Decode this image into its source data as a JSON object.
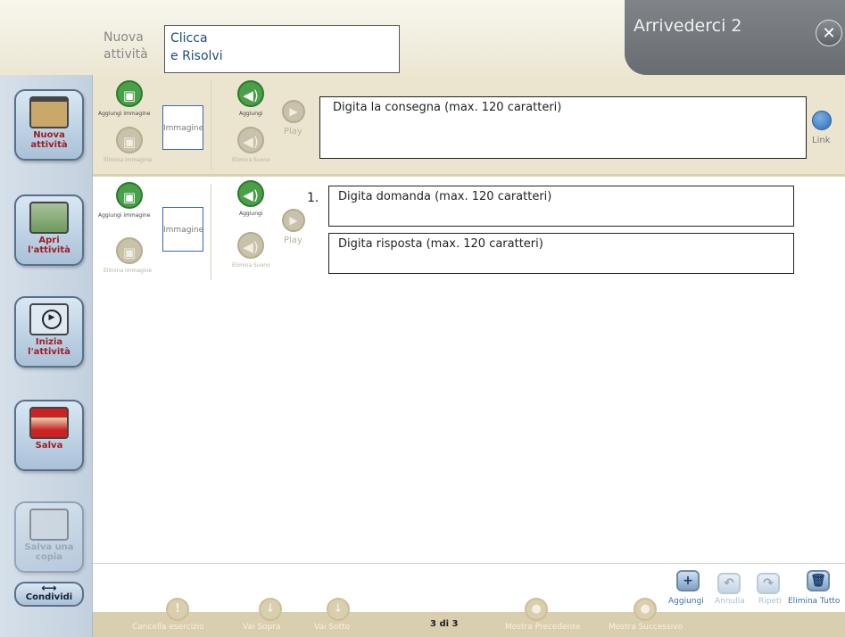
{
  "header": {
    "nuova_attivita": "Nuova attività",
    "title_line1": "Clicca",
    "title_line2": "e Risolvi",
    "app_title": "Arrivederci 2",
    "close_glyph": "✕"
  },
  "sidebar": {
    "items": [
      {
        "label": "Nuova attività",
        "icon": "folder-icon"
      },
      {
        "label": "Apri l'attività",
        "icon": "open-folder-icon"
      },
      {
        "label": "Inizia l'attività",
        "icon": "play-icon"
      },
      {
        "label": "Salva",
        "icon": "save-icon"
      },
      {
        "label": "Salva una copia",
        "icon": "copy-icon"
      }
    ],
    "share_label": "Condividi"
  },
  "instruction": {
    "add_image": "Aggiungi immagine",
    "remove_image": "Elimina immagine",
    "image_placeholder": "Immagine",
    "add_sound": "Aggiungi",
    "remove_sound": "Elimina Suono",
    "play": "Play",
    "text": "Digita  la consegna (max. 120 caratteri)",
    "link": "Link"
  },
  "question": {
    "number": "1.",
    "add_image": "Aggiungi immagine",
    "remove_image": "Elimina immagine",
    "image_placeholder": "Immagine",
    "add_sound": "Aggiungi",
    "remove_sound": "Elimina Suono",
    "play": "Play",
    "question_text": "Digita domanda (max. 120 caratteri)",
    "answer_text": "Digita risposta (max. 120 caratteri)"
  },
  "toolbar": {
    "add": "Aggiungi",
    "undo": "Annulla",
    "redo": "Ripeti",
    "delete_all": "Elimina Tutto"
  },
  "bottom": {
    "delete_exercise": "Cancella esercizio",
    "move_up": "Vai Sopra",
    "move_down": "Vai Sotto",
    "page": "3 di 3",
    "show_prev": "Mostra Precedente",
    "show_next": "Mostra Successivo"
  }
}
